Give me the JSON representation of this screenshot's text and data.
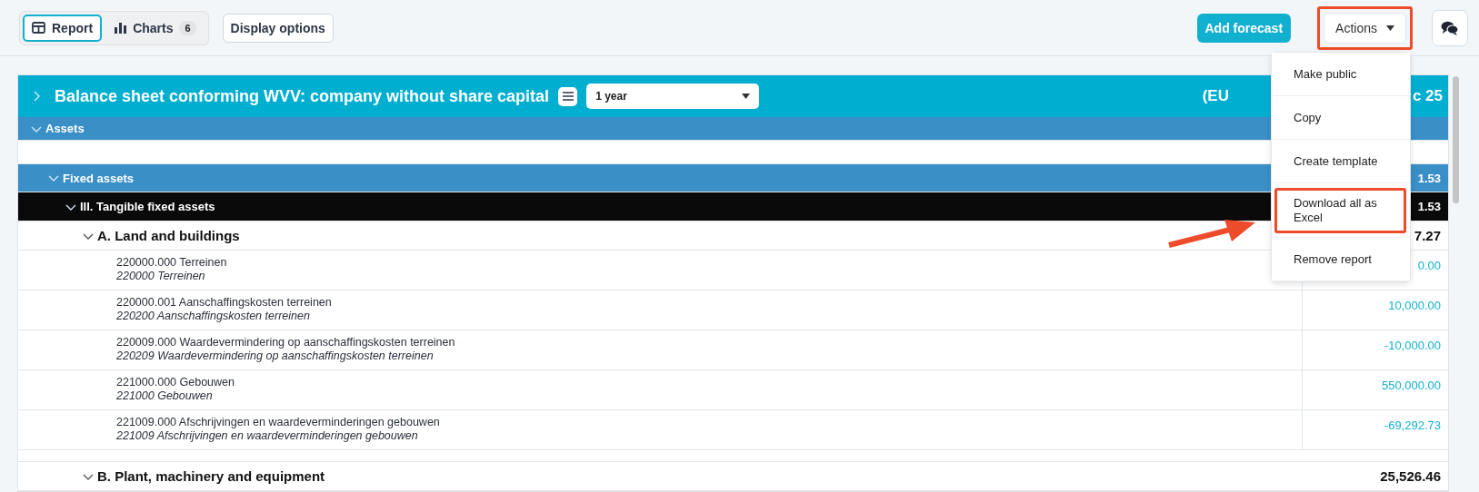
{
  "toolbar": {
    "tabs": [
      {
        "label": "Report",
        "selected": true,
        "kind": "table"
      },
      {
        "label": "Charts",
        "selected": false,
        "kind": "chart",
        "count": "6"
      }
    ],
    "display_options": "Display options",
    "add_forecast": "Add forecast",
    "actions": {
      "label": "Actions",
      "highlighted": true,
      "expanded": true
    }
  },
  "actions_menu": [
    {
      "label": "Make public",
      "highlighted": false
    },
    {
      "label": "Copy",
      "highlighted": false
    },
    {
      "label": "Create template",
      "highlighted": false
    },
    {
      "label": "Download all as Excel",
      "highlighted": true
    },
    {
      "label": "Remove report",
      "highlighted": false
    }
  ],
  "pointer_arrow": true,
  "report": {
    "title": "Balance sheet conforming WVV: company without share capital",
    "expanded": false,
    "period": "1 year",
    "header_left": "(EU",
    "header_right": "c 25",
    "rows": [
      {
        "kind": "section",
        "label": "Assets",
        "expanded": true,
        "children": [
          {
            "kind": "group",
            "label": "Fixed assets",
            "value": "1.53",
            "expanded": true,
            "children": [
              {
                "kind": "subgroup",
                "label": "III. Tangible fixed assets",
                "value": "1.53",
                "expanded": true,
                "children": [
                  {
                    "kind": "category",
                    "label": "A. Land and buildings",
                    "value": "7.27",
                    "expanded": true,
                    "children": [
                      {
                        "kind": "account",
                        "label": "220000.000 Terreinen",
                        "sublabel": "220000 Terreinen",
                        "value": "0.00"
                      },
                      {
                        "kind": "account",
                        "label": "220000.001 Aanschaffingskosten terreinen",
                        "sublabel": "220200 Aanschaffingskosten terreinen",
                        "value": "10,000.00"
                      },
                      {
                        "kind": "account",
                        "label": "220009.000 Waardevermindering op aanschaffingskosten terreinen",
                        "sublabel": "220209 Waardevermindering op aanschaffingskosten terreinen",
                        "value": "-10,000.00"
                      },
                      {
                        "kind": "account",
                        "label": "221000.000 Gebouwen",
                        "sublabel": "221000 Gebouwen",
                        "value": "550,000.00"
                      },
                      {
                        "kind": "account",
                        "label": "221009.000 Afschrijvingen en waardeverminderingen gebouwen",
                        "sublabel": "221009 Afschrijvingen en waardeverminderingen gebouwen",
                        "value": "-69,292.73"
                      }
                    ]
                  },
                  {
                    "kind": "category",
                    "label": "B. Plant, machinery and equipment",
                    "value": "25,526.46",
                    "expanded": true
                  }
                ]
              }
            ]
          }
        ]
      }
    ]
  }
}
